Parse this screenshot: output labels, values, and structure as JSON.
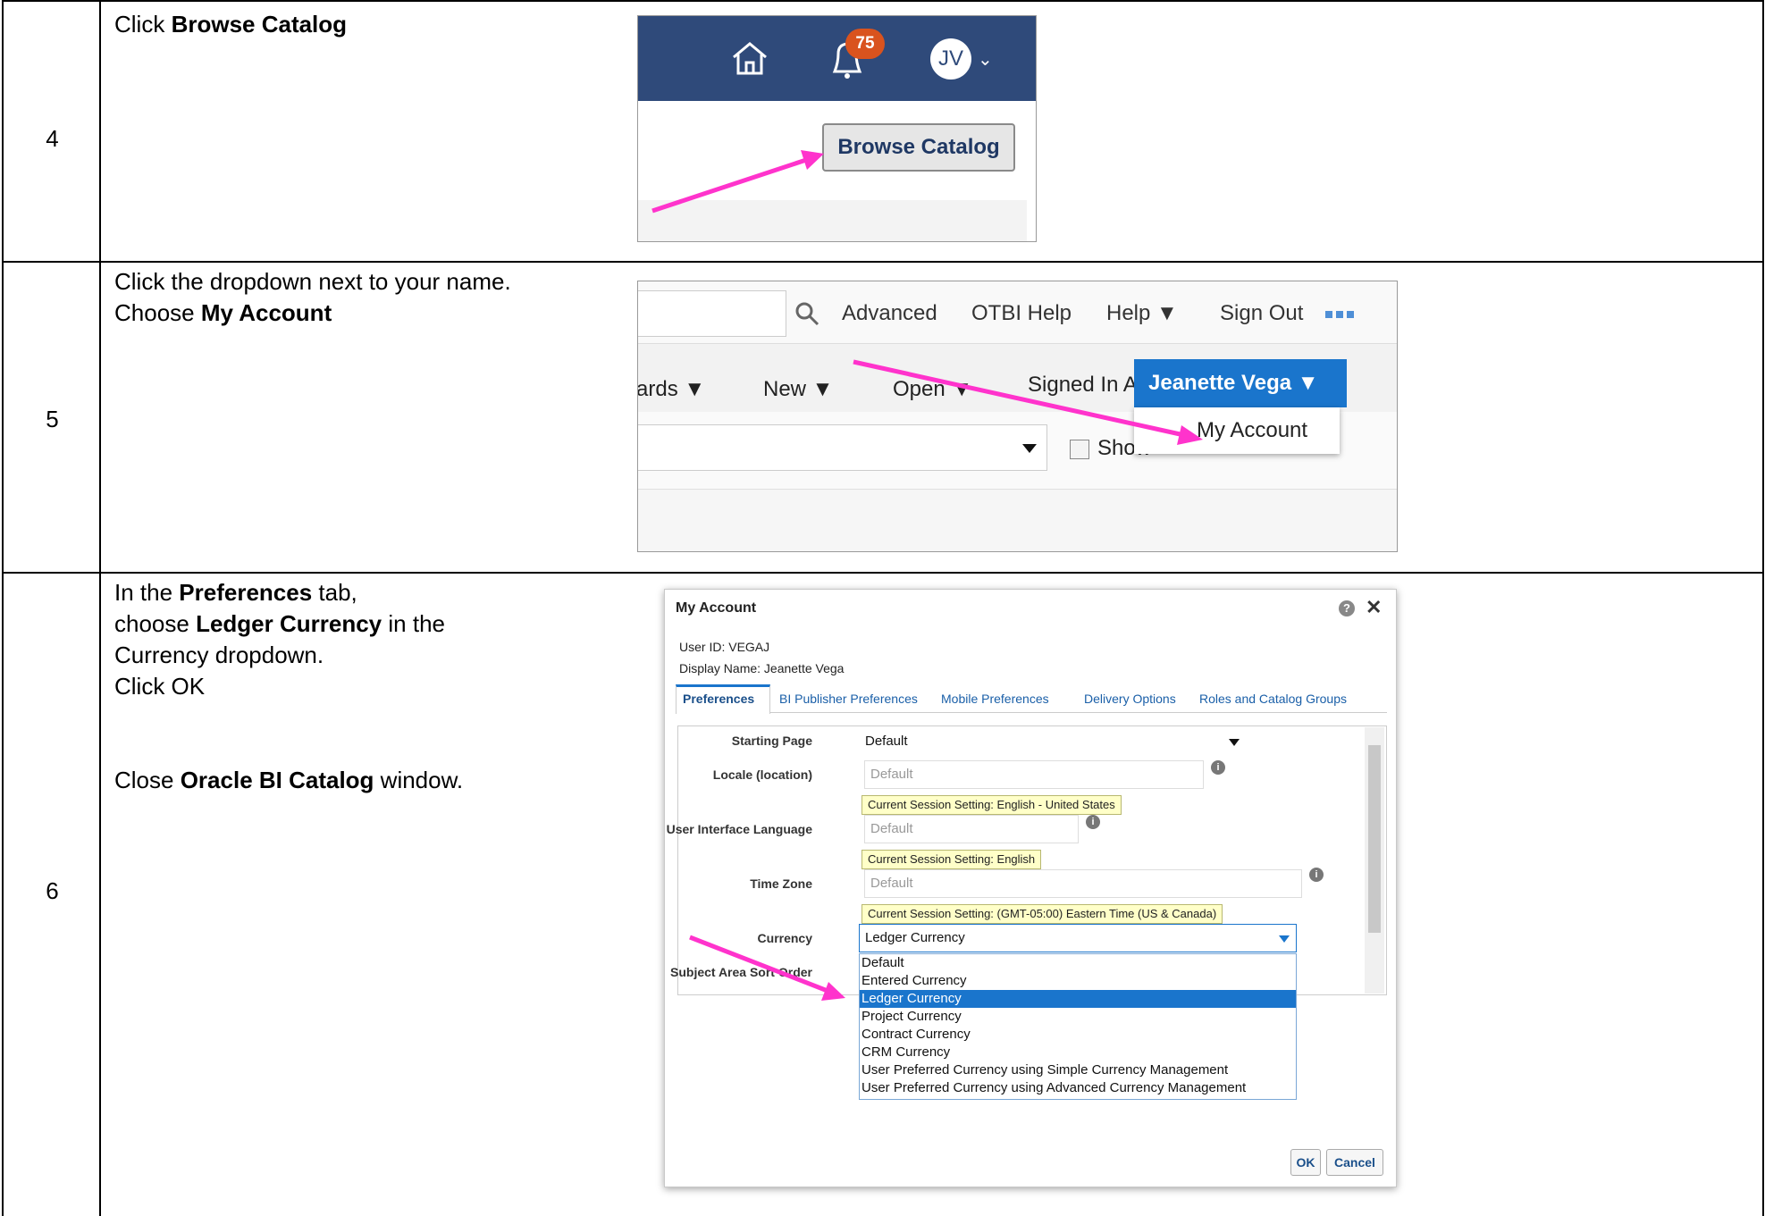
{
  "steps": [
    {
      "number": "4",
      "instruction_pre": "Click ",
      "instruction_bold": "Browse Catalog",
      "shot": {
        "notification_count": "75",
        "avatar_initials": "JV",
        "button_label": "Browse Catalog"
      }
    },
    {
      "number": "5",
      "line1": "Click the dropdown next to your name.",
      "line2_pre": "Choose ",
      "line2_bold": "My Account",
      "shot": {
        "links": [
          "Advanced",
          "OTBI Help",
          "Help ▼",
          "Sign Out"
        ],
        "menus": [
          "ards ▼",
          "New ▼",
          "Open ▼"
        ],
        "signed_in_as": "Signed In As",
        "user_name": "Jeanette Vega ▼",
        "dropdown_item": "My Account",
        "show_label": "Show"
      }
    },
    {
      "number": "6",
      "line1_pre": "In the ",
      "line1_bold": "Preferences",
      "line1_post": " tab,",
      "line2_pre": "choose ",
      "line2_bold": "Ledger Currency",
      "line2_post": " in the",
      "line3": "Currency dropdown.",
      "line4": "Click OK",
      "line5_pre": "Close ",
      "line5_bold": "Oracle BI Catalog",
      "line5_post": " window.",
      "dialog": {
        "title": "My Account",
        "help_glyph": "?",
        "close_glyph": "✕",
        "user_id": "User ID: VEGAJ",
        "display_name": "Display Name: Jeanette Vega",
        "tabs": [
          "Preferences",
          "BI Publisher Preferences",
          "Mobile Preferences",
          "Delivery Options",
          "Roles and Catalog Groups"
        ],
        "starting_page_label": "Starting Page",
        "starting_page_value": "Default",
        "locale_label": "Locale (location)",
        "locale_value": "Default",
        "locale_note": "Current Session Setting: English - United States",
        "ui_lang_label": "User Interface Language",
        "ui_lang_value": "Default",
        "ui_lang_note": "Current Session Setting: English",
        "tz_label": "Time Zone",
        "tz_value": "Default",
        "tz_note": "Current Session Setting: (GMT-05:00) Eastern Time (US & Canada)",
        "currency_label": "Currency",
        "currency_value": "Ledger Currency",
        "sort_label": "Subject Area Sort Order",
        "currency_options": [
          "Default",
          "Entered Currency",
          "Ledger Currency",
          "Project Currency",
          "Contract Currency",
          "CRM Currency",
          "User Preferred Currency using Simple Currency Management",
          "User Preferred Currency using Advanced Currency Management"
        ],
        "selected_option": "Ledger Currency",
        "ok_label": "OK",
        "cancel_label": "Cancel"
      }
    }
  ],
  "colors": {
    "annotation_arrow": "#ff33cc",
    "header_bar": "#2f4a7a",
    "accent_blue": "#1a75cc"
  }
}
